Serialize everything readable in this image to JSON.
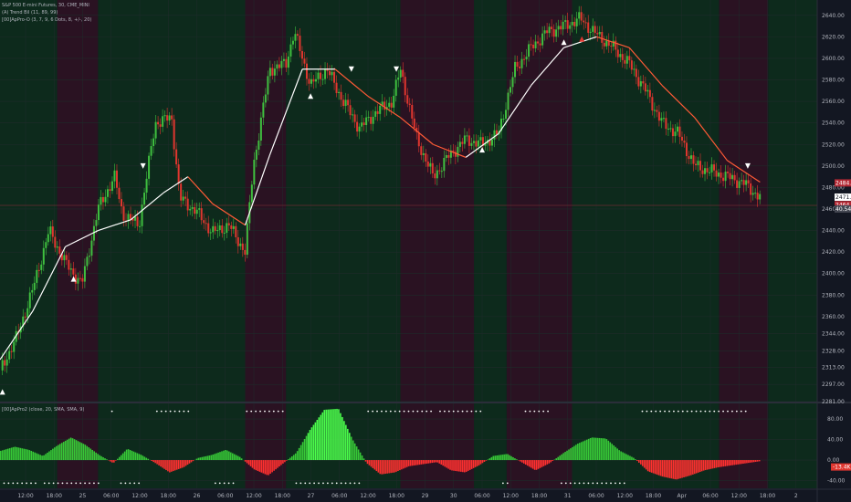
{
  "legends": {
    "symbol": "S&P 500 E-mini Futures, 30, CME_MINI",
    "trend": "(A) Trend Bil (11, 89, 99)",
    "pro": "[00]ApPro-O (3, 7, 9, 6 Dots, 8, +/-, 20)",
    "oscillator": "[00]ApPro2 (close, 20, SMA, SMA, 9)"
  },
  "chart_data": [
    {
      "type": "candlestick",
      "title": "",
      "xlabel": "",
      "ylabel": "",
      "y_ticks": [
        2640,
        2620,
        2600,
        2580,
        2560,
        2540,
        2520,
        2500,
        2480,
        2460,
        2440,
        2420,
        2400,
        2380,
        2360,
        2344,
        2328,
        2313,
        2297,
        2281
      ],
      "x_tick_labels": [
        "12:00",
        "18:00",
        "25",
        "06:00",
        "12:00",
        "18:00",
        "26",
        "06:00",
        "12:00",
        "18:00",
        "27",
        "06:00",
        "12:00",
        "18:00",
        "29",
        "30",
        "06:00",
        "12:00",
        "18:00",
        "31",
        "06:00",
        "12:00",
        "18:00",
        "Apr",
        "06:00",
        "12:00",
        "18:00",
        "2"
      ],
      "price_badges": [
        {
          "label": "2484.25",
          "value": 2484.25,
          "color": "#b22833"
        },
        {
          "label": "2471.00",
          "value": 2471.0,
          "color": "#ffffff"
        },
        {
          "label": "2464.00",
          "value": 2464.0,
          "color": "#b22833"
        },
        {
          "label": "40.54",
          "value": 2460.0,
          "color": "#434651"
        }
      ],
      "background_zones": [
        {
          "from": 0,
          "to": 7,
          "color": "#0d2a1c"
        },
        {
          "from": 7,
          "to": 12,
          "color": "#2a1222"
        },
        {
          "from": 12,
          "to": 30,
          "color": "#0d2a1c"
        },
        {
          "from": 30,
          "to": 35,
          "color": "#2a1222"
        },
        {
          "from": 35,
          "to": 49,
          "color": "#0d2a1c"
        },
        {
          "from": 49,
          "to": 58,
          "color": "#2a1222"
        },
        {
          "from": 58,
          "to": 62,
          "color": "#0d2a1c"
        },
        {
          "from": 62,
          "to": 70,
          "color": "#2a1222"
        },
        {
          "from": 70,
          "to": 88,
          "color": "#0d2a1c"
        },
        {
          "from": 88,
          "to": 94,
          "color": "#2a1222"
        },
        {
          "from": 94,
          "to": 100,
          "color": "#0d2a1c"
        }
      ],
      "series": [
        {
          "x": 0,
          "y": 2310
        },
        {
          "x": 2,
          "y": 2340
        },
        {
          "x": 4,
          "y": 2385
        },
        {
          "x": 6,
          "y": 2440
        },
        {
          "x": 8,
          "y": 2410
        },
        {
          "x": 10,
          "y": 2390
        },
        {
          "x": 12,
          "y": 2460
        },
        {
          "x": 14,
          "y": 2490
        },
        {
          "x": 15,
          "y": 2455
        },
        {
          "x": 17,
          "y": 2445
        },
        {
          "x": 19,
          "y": 2540
        },
        {
          "x": 21,
          "y": 2545
        },
        {
          "x": 22,
          "y": 2470
        },
        {
          "x": 24,
          "y": 2458
        },
        {
          "x": 26,
          "y": 2438
        },
        {
          "x": 28,
          "y": 2445
        },
        {
          "x": 30,
          "y": 2420
        },
        {
          "x": 31,
          "y": 2500
        },
        {
          "x": 33,
          "y": 2590
        },
        {
          "x": 35,
          "y": 2595
        },
        {
          "x": 36,
          "y": 2625
        },
        {
          "x": 38,
          "y": 2575
        },
        {
          "x": 40,
          "y": 2590
        },
        {
          "x": 42,
          "y": 2560
        },
        {
          "x": 44,
          "y": 2535
        },
        {
          "x": 46,
          "y": 2550
        },
        {
          "x": 48,
          "y": 2560
        },
        {
          "x": 49,
          "y": 2590
        },
        {
          "x": 51,
          "y": 2525
        },
        {
          "x": 53,
          "y": 2490
        },
        {
          "x": 55,
          "y": 2510
        },
        {
          "x": 57,
          "y": 2525
        },
        {
          "x": 59,
          "y": 2520
        },
        {
          "x": 61,
          "y": 2530
        },
        {
          "x": 63,
          "y": 2590
        },
        {
          "x": 65,
          "y": 2610
        },
        {
          "x": 67,
          "y": 2625
        },
        {
          "x": 69,
          "y": 2630
        },
        {
          "x": 71,
          "y": 2637
        },
        {
          "x": 73,
          "y": 2622
        },
        {
          "x": 75,
          "y": 2610
        },
        {
          "x": 77,
          "y": 2595
        },
        {
          "x": 79,
          "y": 2570
        },
        {
          "x": 81,
          "y": 2540
        },
        {
          "x": 83,
          "y": 2530
        },
        {
          "x": 85,
          "y": 2500
        },
        {
          "x": 87,
          "y": 2495
        },
        {
          "x": 89,
          "y": 2490
        },
        {
          "x": 91,
          "y": 2484
        },
        {
          "x": 93,
          "y": 2471
        }
      ],
      "trend_line": [
        {
          "x": 0,
          "y": 2320
        },
        {
          "x": 4,
          "y": 2365
        },
        {
          "x": 8,
          "y": 2425
        },
        {
          "x": 12,
          "y": 2440
        },
        {
          "x": 16,
          "y": 2450
        },
        {
          "x": 20,
          "y": 2475
        },
        {
          "x": 23,
          "y": 2490
        },
        {
          "x": 26,
          "y": 2465
        },
        {
          "x": 30,
          "y": 2445
        },
        {
          "x": 33,
          "y": 2510
        },
        {
          "x": 37,
          "y": 2590
        },
        {
          "x": 41,
          "y": 2590
        },
        {
          "x": 45,
          "y": 2565
        },
        {
          "x": 49,
          "y": 2545
        },
        {
          "x": 53,
          "y": 2520
        },
        {
          "x": 57,
          "y": 2508
        },
        {
          "x": 61,
          "y": 2530
        },
        {
          "x": 65,
          "y": 2575
        },
        {
          "x": 69,
          "y": 2610
        },
        {
          "x": 73,
          "y": 2620
        },
        {
          "x": 77,
          "y": 2610
        },
        {
          "x": 81,
          "y": 2575
        },
        {
          "x": 85,
          "y": 2545
        },
        {
          "x": 89,
          "y": 2505
        },
        {
          "x": 93,
          "y": 2485
        }
      ],
      "markers": [
        {
          "x": 0.3,
          "y": 2290,
          "dir": "up"
        },
        {
          "x": 9,
          "y": 2395,
          "dir": "up"
        },
        {
          "x": 17.5,
          "y": 2500,
          "dir": "down"
        },
        {
          "x": 38,
          "y": 2565,
          "dir": "up"
        },
        {
          "x": 43,
          "y": 2590,
          "dir": "down"
        },
        {
          "x": 48.5,
          "y": 2590,
          "dir": "down"
        },
        {
          "x": 59,
          "y": 2515,
          "dir": "up"
        },
        {
          "x": 69,
          "y": 2615,
          "dir": "up"
        },
        {
          "x": 71.2,
          "y": 2618,
          "dir": "up-red"
        },
        {
          "x": 91.5,
          "y": 2500,
          "dir": "down"
        }
      ]
    },
    {
      "type": "histogram",
      "title": "",
      "y_ticks": [
        80,
        40,
        0,
        -40
      ],
      "value_badge": {
        "label": "-13.4K",
        "value": -13.4
      },
      "values": [
        18,
        26,
        20,
        8,
        28,
        44,
        30,
        10,
        -6,
        22,
        10,
        -6,
        -24,
        -14,
        4,
        10,
        20,
        6,
        -18,
        -30,
        -8,
        14,
        60,
        98,
        100,
        40,
        -6,
        -28,
        -24,
        -12,
        -8,
        -4,
        -20,
        -24,
        -10,
        8,
        12,
        -4,
        -20,
        -6,
        14,
        32,
        44,
        42,
        18,
        4,
        -22,
        -32,
        -38,
        -30,
        -20,
        -14,
        -10,
        -6,
        -2
      ]
    }
  ]
}
